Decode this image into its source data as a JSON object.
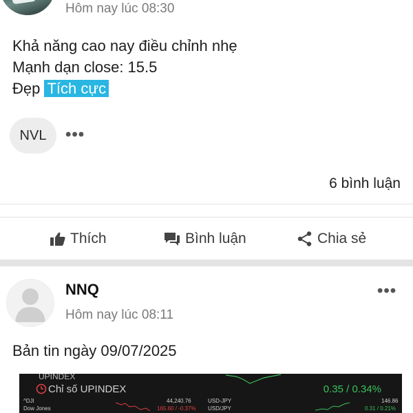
{
  "post1": {
    "timestamp": "Hôm nay lúc 08:30",
    "lines": [
      "Khả năng cao nay điều chỉnh nhẹ",
      "Mạnh dạn close: 15.5",
      "Đẹp"
    ],
    "sentiment_tag": "Tích cực",
    "stock_tag": "NVL",
    "more_icon": "•••",
    "comments": "6 bình luận"
  },
  "actions": {
    "like": "Thích",
    "comment": "Bình luận",
    "share": "Chia sẻ"
  },
  "post2": {
    "author": "NNQ",
    "timestamp": "Hôm nay lúc 08:11",
    "more_icon": "•••",
    "text": "Bản tin ngày 09/07/2025",
    "image": {
      "header_partial": "UPINDEX",
      "index_label": "Chỉ số UPINDEX",
      "index_change": "0.35 / 0.34%",
      "dji_label": "^DJI",
      "dji_name": "Dow Jones",
      "dji_value": "44,240.76",
      "dji_change": "165.60 / -0.37%",
      "usdjpy_label": "USD-JPY",
      "usdjpy_name": "USD/JPY",
      "usdjpy_value": "146.86",
      "usdjpy_change": "0.31 / 0.21%"
    }
  },
  "colors": {
    "tag_bg": "#29b6e3",
    "divider": "#e4e4e4",
    "positive": "#39c25a",
    "negative": "#e04040"
  }
}
